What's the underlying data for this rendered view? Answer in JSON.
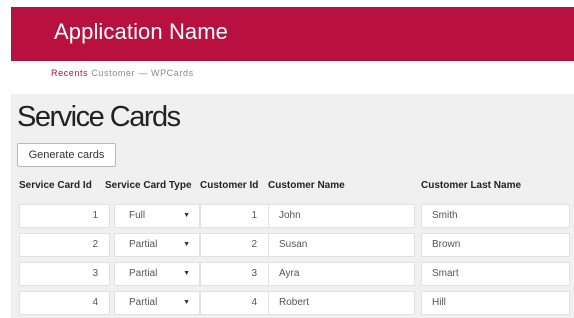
{
  "app": {
    "name": "Application Name"
  },
  "breadcrumb": {
    "recents": "Recents",
    "customer": "Customer",
    "separator": "—",
    "current": "WPCards"
  },
  "page": {
    "title": "Service Cards",
    "generate_label": "Generate cards"
  },
  "table": {
    "headers": [
      "Service Card Id",
      "Service Card Type",
      "Customer Id",
      "Customer Name",
      "Customer Last Name"
    ],
    "rows": [
      {
        "id": "1",
        "type": "Full",
        "customer_id": "1",
        "name": "John",
        "last_name": "Smith"
      },
      {
        "id": "2",
        "type": "Partial",
        "customer_id": "2",
        "name": "Susan",
        "last_name": "Brown"
      },
      {
        "id": "3",
        "type": "Partial",
        "customer_id": "3",
        "name": "Ayra",
        "last_name": "Smart"
      },
      {
        "id": "4",
        "type": "Partial",
        "customer_id": "4",
        "name": "Robert",
        "last_name": "Hill"
      }
    ]
  },
  "colors": {
    "brand": "#b8103f",
    "content_bg": "#f0f0f0"
  },
  "icons": {
    "select_arrow": "caret-down-icon"
  }
}
